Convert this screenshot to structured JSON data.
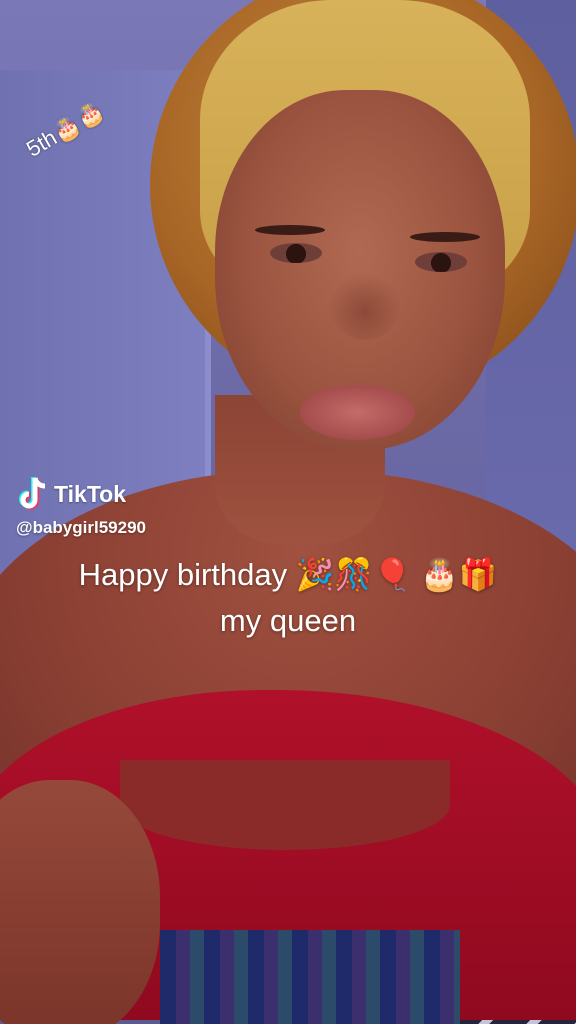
{
  "sticker": {
    "text": "5th🎂🎂"
  },
  "watermark": {
    "brand": "TikTok",
    "handle": "@babygirl59290"
  },
  "caption": {
    "line1": "Happy birthday 🎉🎊🎈 🎂🎁",
    "line2": "my queen"
  }
}
